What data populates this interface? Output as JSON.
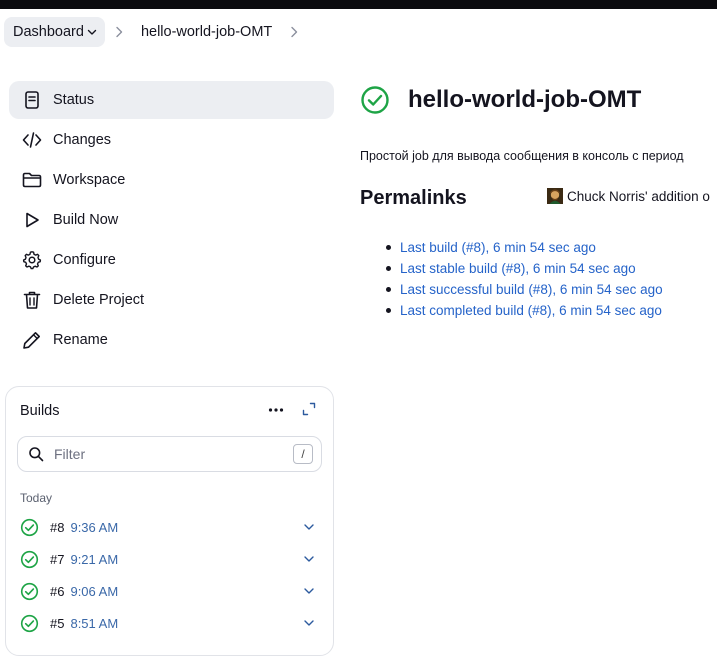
{
  "breadcrumb": {
    "items": [
      "Dashboard",
      "hello-world-job-OMT"
    ]
  },
  "sidebar": {
    "items": [
      {
        "label": "Status",
        "icon": "document-icon",
        "active": true
      },
      {
        "label": "Changes",
        "icon": "code-icon"
      },
      {
        "label": "Workspace",
        "icon": "folder-icon"
      },
      {
        "label": "Build Now",
        "icon": "play-icon"
      },
      {
        "label": "Configure",
        "icon": "gear-icon"
      },
      {
        "label": "Delete Project",
        "icon": "trash-icon"
      },
      {
        "label": "Rename",
        "icon": "pencil-icon"
      }
    ]
  },
  "builds": {
    "title": "Builds",
    "filter_placeholder": "Filter",
    "filter_shortcut": "/",
    "group_label": "Today",
    "rows": [
      {
        "number": "#8",
        "time": "9:36 AM",
        "status": "success"
      },
      {
        "number": "#7",
        "time": "9:21 AM",
        "status": "success"
      },
      {
        "number": "#6",
        "time": "9:06 AM",
        "status": "success"
      },
      {
        "number": "#5",
        "time": "8:51 AM",
        "status": "success"
      }
    ]
  },
  "job": {
    "title": "hello-world-job-OMT",
    "status": "success",
    "description": "Простой job для вывода сообщения в консоль с период"
  },
  "permalinks": {
    "title": "Permalinks",
    "chuck_text": "Chuck Norris' addition o",
    "links": [
      "Last build (#8), 6 min 54 sec ago",
      "Last stable build (#8), 6 min 54 sec ago",
      "Last successful build (#8), 6 min 54 sec ago",
      "Last completed build (#8), 6 min 54 sec ago"
    ]
  },
  "colors": {
    "success": "#1ea446",
    "link": "#2563c9",
    "active_bg": "#eceef2"
  }
}
